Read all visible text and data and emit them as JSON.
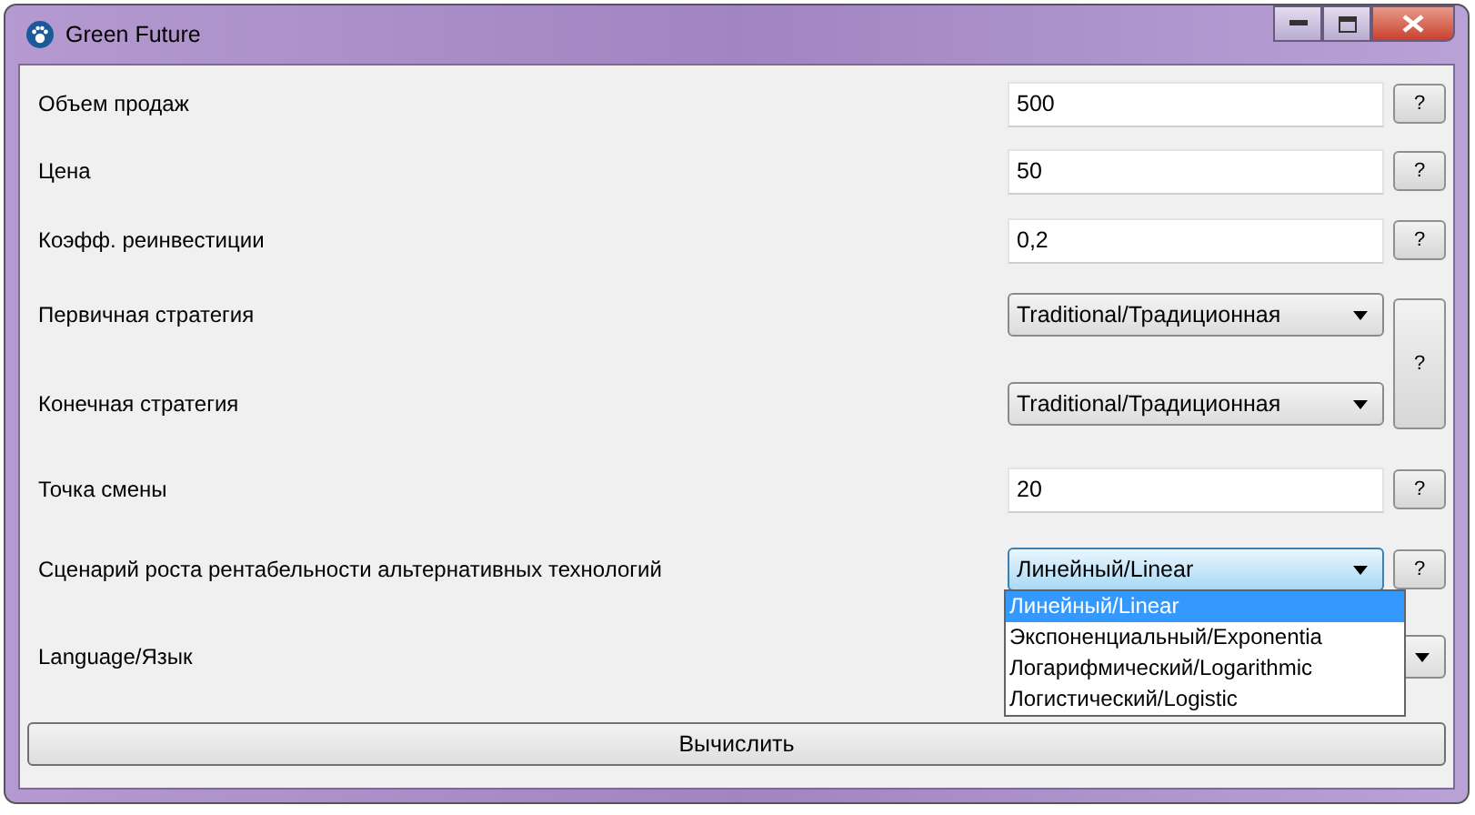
{
  "window": {
    "title": "Green Future"
  },
  "rows": [
    {
      "label": "Объем продаж",
      "kind": "input",
      "value": "500",
      "help": "?"
    },
    {
      "label": "Цена",
      "kind": "input",
      "value": "50",
      "help": "?"
    },
    {
      "label": "Коэфф. реинвестиции",
      "kind": "input",
      "value": "0,2",
      "help": "?"
    },
    {
      "label": "Первичная стратегия",
      "kind": "select",
      "value": "Traditional/Традиционная",
      "help": "?",
      "help_spans_next": true
    },
    {
      "label": "Конечная стратегия",
      "kind": "select",
      "value": "Traditional/Традиционная"
    },
    {
      "label": "Точка смены",
      "kind": "input",
      "value": "20",
      "help": "?"
    },
    {
      "label": "Сценарий роста рентабельности альтернативных технологий",
      "kind": "select",
      "value": "Линейный/Linear",
      "help": "?",
      "open": true,
      "options": [
        {
          "label": "Линейный/Linear",
          "selected": true
        },
        {
          "label": "Экспоненциальный/Exponentia",
          "selected": false
        },
        {
          "label": "Логарифмический/Logarithmic",
          "selected": false
        },
        {
          "label": "Логистический/Logistic",
          "selected": false
        }
      ]
    },
    {
      "label": "Language/Язык",
      "kind": "select"
    }
  ],
  "compute_button": "Вычислить"
}
